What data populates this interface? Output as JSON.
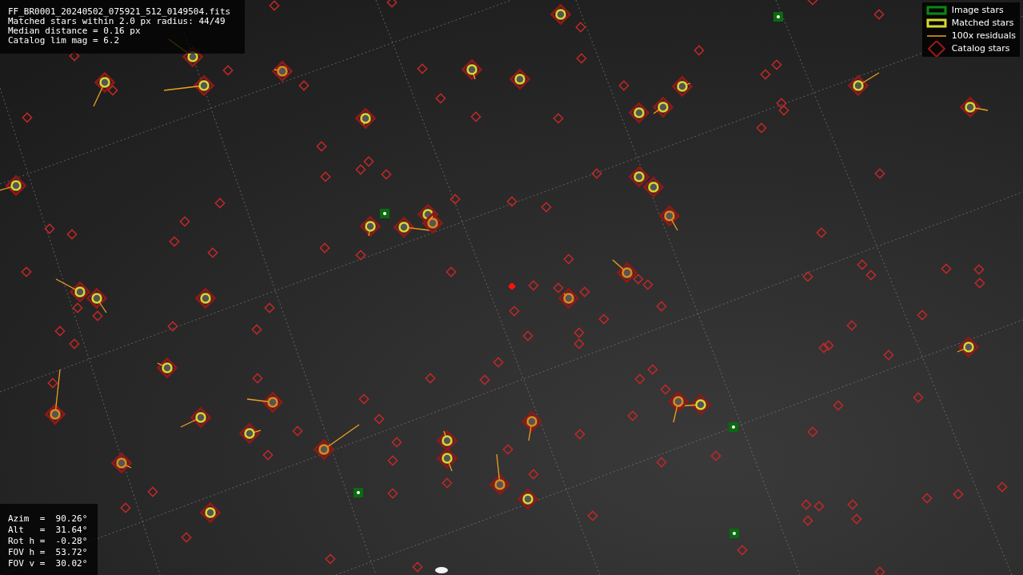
{
  "info_lines": [
    "FF_BR0001_20240502_075921_512_0149504.fits",
    "Matched stars within 2.0 px radius: 44/49",
    "Median distance = 0.16 px",
    "Catalog lim mag = 6.2"
  ],
  "legend": [
    {
      "kind": "image",
      "label": "Image stars"
    },
    {
      "kind": "matched",
      "label": "Matched stars"
    },
    {
      "kind": "residual",
      "label": "100x residuals"
    },
    {
      "kind": "catalog",
      "label": "Catalog stars"
    }
  ],
  "pointing": [
    {
      "label": "Azim  =",
      "value": "90.26°"
    },
    {
      "label": "Alt   =",
      "value": "31.64°"
    },
    {
      "label": "Rot h =",
      "value": "-0.28°"
    },
    {
      "label": "FOV h =",
      "value": "53.72°"
    },
    {
      "label": "FOV v =",
      "value": "30.02°"
    }
  ]
}
